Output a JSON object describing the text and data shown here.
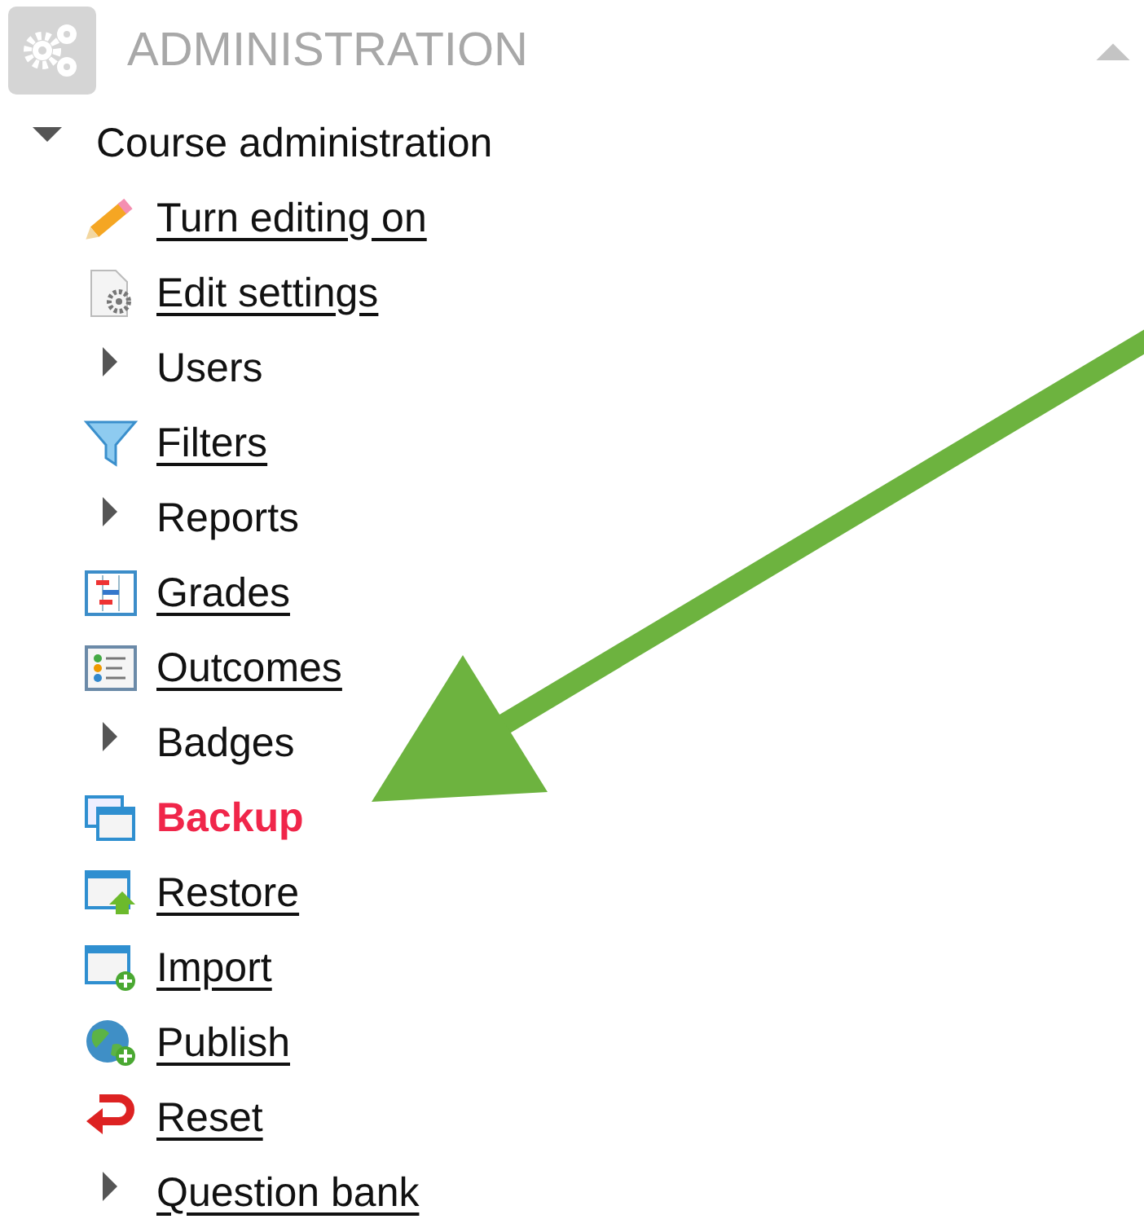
{
  "block": {
    "title": "ADMINISTRATION",
    "expanded": true
  },
  "tree": {
    "label": "Course administration",
    "expanded": true,
    "children": [
      {
        "label": "Turn editing on",
        "kind": "pencil",
        "link": true,
        "highlighted": false
      },
      {
        "label": "Edit settings",
        "kind": "settings",
        "link": true,
        "highlighted": false
      },
      {
        "label": "Users",
        "kind": "branch",
        "expanded": false,
        "link": false,
        "highlighted": false
      },
      {
        "label": "Filters",
        "kind": "filter",
        "link": true,
        "highlighted": false
      },
      {
        "label": "Reports",
        "kind": "branch",
        "expanded": false,
        "link": false,
        "highlighted": false
      },
      {
        "label": "Grades",
        "kind": "grades",
        "link": true,
        "highlighted": false
      },
      {
        "label": "Outcomes",
        "kind": "outcomes",
        "link": true,
        "highlighted": false
      },
      {
        "label": "Badges",
        "kind": "branch",
        "expanded": false,
        "link": false,
        "highlighted": false
      },
      {
        "label": "Backup",
        "kind": "backup",
        "link": true,
        "highlighted": true
      },
      {
        "label": "Restore",
        "kind": "restore",
        "link": true,
        "highlighted": false
      },
      {
        "label": "Import",
        "kind": "import",
        "link": true,
        "highlighted": false
      },
      {
        "label": "Publish",
        "kind": "publish",
        "link": true,
        "highlighted": false
      },
      {
        "label": "Reset",
        "kind": "reset",
        "link": true,
        "highlighted": false
      },
      {
        "label": "Question bank",
        "kind": "branch",
        "expanded": false,
        "link": true,
        "highlighted": false
      }
    ]
  }
}
